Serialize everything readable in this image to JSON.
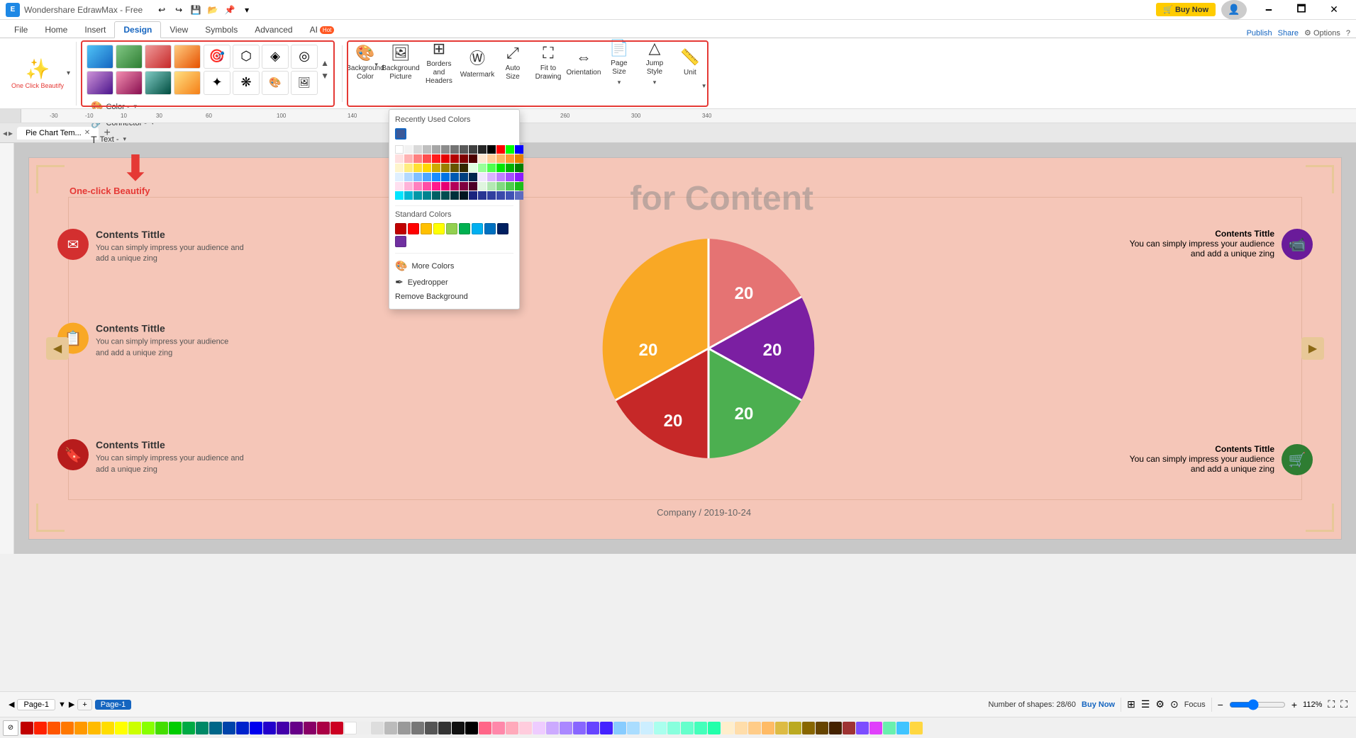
{
  "app": {
    "title": "Wondershare EdrawMax - Free",
    "icon": "E"
  },
  "titlebar": {
    "buy_now": "🛒 Buy Now",
    "undo": "↩",
    "redo": "↪",
    "save": "💾",
    "open": "📂",
    "save2": "💾",
    "pin": "📌",
    "dots": "⋯",
    "minimize": "🗕",
    "maximize": "🗖",
    "close": "✕"
  },
  "menu": {
    "file": "File",
    "home": "Home",
    "insert": "Insert",
    "design": "Design",
    "view": "View",
    "symbols": "Symbols",
    "advanced": "Advanced",
    "ai": "AI",
    "ai_badge": "Hot",
    "publish": "Publish",
    "share": "Share",
    "options": "Options",
    "help": "?"
  },
  "ribbon": {
    "one_click_beautify": "One Click Beautify",
    "color_label": "Color -",
    "connector_label": "Connector -",
    "text_label": "Text -",
    "beautify_section_label": "Beautify",
    "background_color": "Background Color",
    "background_picture": "Background Picture",
    "borders_headers": "Borders and Headers",
    "watermark": "Watermark",
    "auto_size": "Auto Size",
    "fit_to_drawing": "Fit to Drawing",
    "orientation": "Orientation",
    "page_size": "Page Size",
    "jump_style": "Jump Style",
    "unit": "Unit"
  },
  "tabs": {
    "items": [
      "File",
      "Home",
      "Insert",
      "Design",
      "View",
      "Symbols",
      "Advanced",
      "AI"
    ],
    "active": "Design"
  },
  "page_tabs": {
    "items": [
      {
        "label": "Pie Chart Tem...",
        "active": true
      }
    ],
    "add": "+"
  },
  "color_picker": {
    "recently_used_title": "Recently Used Colors",
    "recently_used": [
      "#3b5998"
    ],
    "standard_title": "Standard Colors",
    "more_colors": "More Colors",
    "eyedropper": "Eyedropper",
    "remove_background": "Remove Background",
    "color_grid_rows": [
      [
        "#ffffff",
        "#f2f2f2",
        "#e6e6e6",
        "#d9d9d9",
        "#cccccc",
        "#bfbfbf",
        "#b2b2b2",
        "#a6a6a6",
        "#999999",
        "#8c8c8c",
        "#808080",
        "#737373",
        "#666666",
        "#000000"
      ],
      [
        "#ffcccc",
        "#ff9999",
        "#ff6666",
        "#ff3333",
        "#ff0000",
        "#cc0000",
        "#990000",
        "#660000",
        "#330000",
        "#ffe5cc",
        "#ffcc99",
        "#ffb266",
        "#ff9933",
        "#ff8000"
      ],
      [
        "#ffe5cc",
        "#ffe0b2",
        "#ffcc80",
        "#ffb74d",
        "#ffa726",
        "#fb8c00",
        "#f57c00",
        "#ef6c00",
        "#e65100",
        "#fff9c4",
        "#fff176",
        "#ffee58",
        "#ffd600",
        "#f9a825"
      ],
      [
        "#e8f5e9",
        "#c8e6c9",
        "#a5d6a7",
        "#81c784",
        "#66bb6a",
        "#4caf50",
        "#43a047",
        "#388e3c",
        "#2e7d32",
        "#e3f2fd",
        "#bbdefb",
        "#90caf9",
        "#64b5f6",
        "#42a5f5"
      ],
      [
        "#e1f5fe",
        "#b3e5fc",
        "#81d4fa",
        "#4fc3f7",
        "#29b6f6",
        "#039be5",
        "#0288d1",
        "#0277bd",
        "#01579b",
        "#ede7f6",
        "#d1c4e9",
        "#b39ddb",
        "#9575cd",
        "#7e57c2"
      ],
      [
        "#f3e5f5",
        "#e1bee7",
        "#ce93d8",
        "#ba68c8",
        "#ab47bc",
        "#8e24aa",
        "#7b1fa2",
        "#6a1b9a",
        "#4a148c",
        "#fce4ec",
        "#f8bbd0",
        "#f48fb1",
        "#f06292",
        "#ec407a"
      ]
    ],
    "standard_colors": [
      "#c00000",
      "#ff0000",
      "#ffc000",
      "#ffff00",
      "#92d050",
      "#00b050",
      "#00b0f0",
      "#0070c0",
      "#002060",
      "#7030a0",
      "#000000",
      "#ffffff",
      "#d9d9d9",
      "#595959"
    ]
  },
  "canvas": {
    "title": "for Content",
    "footer": "Company / 2019-10-24",
    "contents": [
      {
        "id": 1,
        "title": "Contents Tittle",
        "text": "You can simply impress your audience and add a unique zing",
        "icon": "✉",
        "color": "#d32f2f",
        "position": "top-left"
      },
      {
        "id": 2,
        "title": "Contents Tittle",
        "text": "You can simply impress your audience and add a unique zing",
        "icon": "📹",
        "color": "#6a1b9a",
        "position": "top-right"
      },
      {
        "id": 3,
        "title": "Contents Tittle",
        "text": "You can simply impress your audience and add a unique zing",
        "icon": "📋",
        "color": "#f9a825",
        "position": "mid-left"
      },
      {
        "id": 4,
        "title": "Contents Tittle",
        "text": "You can simply impress your audience and add a unique zing",
        "icon": "🛒",
        "color": "#2e7d32",
        "position": "bot-right"
      },
      {
        "id": 5,
        "title": "Contents Tittle",
        "text": "You can simply impress your audience and add a unique zing",
        "icon": "🔖",
        "color": "#b71c1c",
        "position": "bot-left"
      }
    ],
    "pie_slices": [
      {
        "label": "20",
        "color": "#e57373",
        "startAngle": 0,
        "endAngle": 72
      },
      {
        "label": "20",
        "color": "#7b1fa2",
        "startAngle": 72,
        "endAngle": 144
      },
      {
        "label": "20",
        "color": "#4caf50",
        "startAngle": 144,
        "endAngle": 216
      },
      {
        "label": "20",
        "color": "#c62828",
        "startAngle": 216,
        "endAngle": 288
      },
      {
        "label": "20",
        "color": "#f9a825",
        "startAngle": 288,
        "endAngle": 360
      }
    ]
  },
  "statusbar": {
    "page": "Page-1",
    "add": "+",
    "page_name": "Page-1",
    "shapes_info": "Number of shapes: 28/60",
    "buy_now": "Buy Now",
    "zoom": "112%",
    "fit": "Fit"
  },
  "palette_colors": [
    "#c00000",
    "#ff0000",
    "#ff4d00",
    "#ff6600",
    "#ff8c00",
    "#ffa500",
    "#ffd700",
    "#ffff00",
    "#adff2f",
    "#00ff00",
    "#00e676",
    "#00bcd4",
    "#2196f3",
    "#3f51b5",
    "#673ab7",
    "#9c27b0",
    "#e91e63",
    "#f06292",
    "#ffffff",
    "#e0e0e0",
    "#bdbdbd",
    "#9e9e9e",
    "#757575",
    "#424242",
    "#212121",
    "#000000"
  ]
}
